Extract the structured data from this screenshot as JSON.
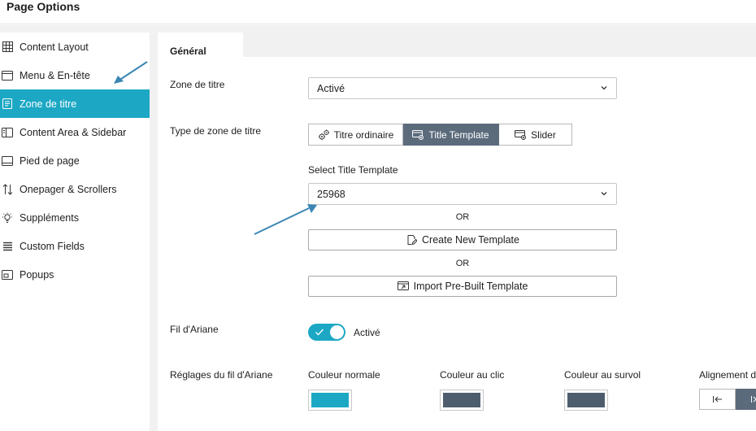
{
  "header": {
    "title": "Page Options"
  },
  "sidebar": {
    "items": [
      {
        "label": "Content Layout",
        "icon": "layout-grid-icon",
        "active": false
      },
      {
        "label": "Menu & En-tête",
        "icon": "window-header-icon",
        "active": false
      },
      {
        "label": "Zone de titre",
        "icon": "title-area-icon",
        "active": true
      },
      {
        "label": "Content Area & Sidebar",
        "icon": "sidebar-layout-icon",
        "active": false
      },
      {
        "label": "Pied de page",
        "icon": "footer-icon",
        "active": false
      },
      {
        "label": "Onepager & Scrollers",
        "icon": "up-down-arrows-icon",
        "active": false
      },
      {
        "label": "Suppléments",
        "icon": "lightbulb-icon",
        "active": false
      },
      {
        "label": "Custom Fields",
        "icon": "list-lines-icon",
        "active": false
      },
      {
        "label": "Popups",
        "icon": "popup-icon",
        "active": false
      }
    ]
  },
  "tabs": {
    "general": "Général"
  },
  "form": {
    "title_zone": {
      "label": "Zone de titre",
      "value": "Activé"
    },
    "title_zone_type": {
      "label": "Type de zone de titre",
      "options": [
        {
          "label": "Titre ordinaire",
          "icon": "gears-icon",
          "active": false
        },
        {
          "label": "Title Template",
          "icon": "template-icon",
          "active": true
        },
        {
          "label": "Slider",
          "icon": "slider-icon",
          "active": false
        }
      ]
    },
    "select_template": {
      "label": "Select Title Template",
      "value": "25968"
    },
    "or_1": "OR",
    "create_template": "Create New Template",
    "or_2": "OR",
    "import_template": "Import Pre-Built Template",
    "breadcrumbs": {
      "label": "Fil d'Ariane",
      "state": "Activé",
      "enabled": true
    },
    "breadcrumb_settings": {
      "label": "Réglages du fil d'Ariane",
      "normal_color": {
        "label": "Couleur normale",
        "value": "#1ca8c4"
      },
      "click_color": {
        "label": "Couleur au clic",
        "value": "#4d5d6e"
      },
      "hover_color": {
        "label": "Couleur au survol",
        "value": "#4d5d6e"
      },
      "alignment": {
        "label": "Alignement d"
      }
    }
  },
  "colors": {
    "accent": "#1ca8c4",
    "segment_active": "#5b6b7c",
    "annotation_arrow": "#3a86b4"
  }
}
